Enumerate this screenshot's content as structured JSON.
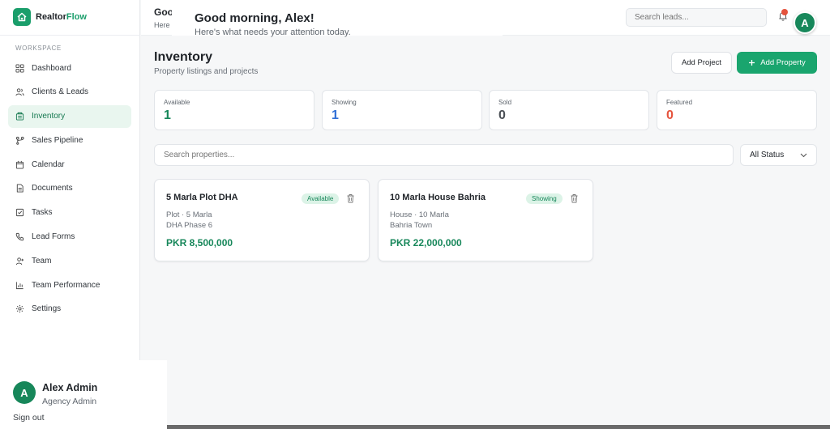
{
  "brand": {
    "name_a": "Realtor",
    "name_b": "Flow",
    "accent": "#1a9e6b"
  },
  "sidebar": {
    "section_label": "WORKSPACE",
    "items": [
      {
        "label": "Dashboard",
        "icon": "grid-icon",
        "active": false
      },
      {
        "label": "Clients & Leads",
        "icon": "users-icon",
        "active": false
      },
      {
        "label": "Inventory",
        "icon": "building-icon",
        "active": true
      },
      {
        "label": "Sales Pipeline",
        "icon": "pipeline-icon",
        "active": false
      },
      {
        "label": "Calendar",
        "icon": "calendar-icon",
        "active": false
      },
      {
        "label": "Documents",
        "icon": "document-icon",
        "active": false
      },
      {
        "label": "Tasks",
        "icon": "checkbox-icon",
        "active": false
      },
      {
        "label": "Lead Forms",
        "icon": "phone-icon",
        "active": false
      },
      {
        "label": "Team",
        "icon": "user-plus-icon",
        "active": false
      },
      {
        "label": "Team Performance",
        "icon": "bar-chart-icon",
        "active": false
      },
      {
        "label": "Settings",
        "icon": "gear-icon",
        "active": false
      }
    ],
    "user": {
      "initial": "A",
      "name": "Alex Admin",
      "role": "Agency Admin",
      "sign_out": "Sign out"
    }
  },
  "topbar": {
    "title_clip": "Goo",
    "sub_clip": "Here",
    "greeting": "Good morning, Alex!",
    "greeting_sub": "Here's what needs your attention today.",
    "search_placeholder": "Search leads...",
    "avatar_initial": "A"
  },
  "main": {
    "title": "Inventory",
    "subtitle": "Property listings and projects",
    "add_project_label": "Add Project",
    "add_property_label": "Add Property",
    "stats": [
      {
        "label": "Available",
        "value": "1",
        "color": "#17875a"
      },
      {
        "label": "Showing",
        "value": "1",
        "color": "#2f6fd6"
      },
      {
        "label": "Sold",
        "value": "0",
        "color": "#4a4f55"
      },
      {
        "label": "Featured",
        "value": "0",
        "color": "#e5533d"
      }
    ],
    "search_placeholder": "Search properties...",
    "status_filter": "All Status",
    "properties": [
      {
        "title": "5 Marla Plot DHA",
        "status": "Available",
        "meta": "Plot · 5 Marla",
        "location": "DHA Phase 6",
        "price": "PKR 8,500,000"
      },
      {
        "title": "10 Marla House Bahria",
        "status": "Showing",
        "meta": "House · 10 Marla",
        "location": "Bahria Town",
        "price": "PKR 22,000,000"
      }
    ]
  }
}
